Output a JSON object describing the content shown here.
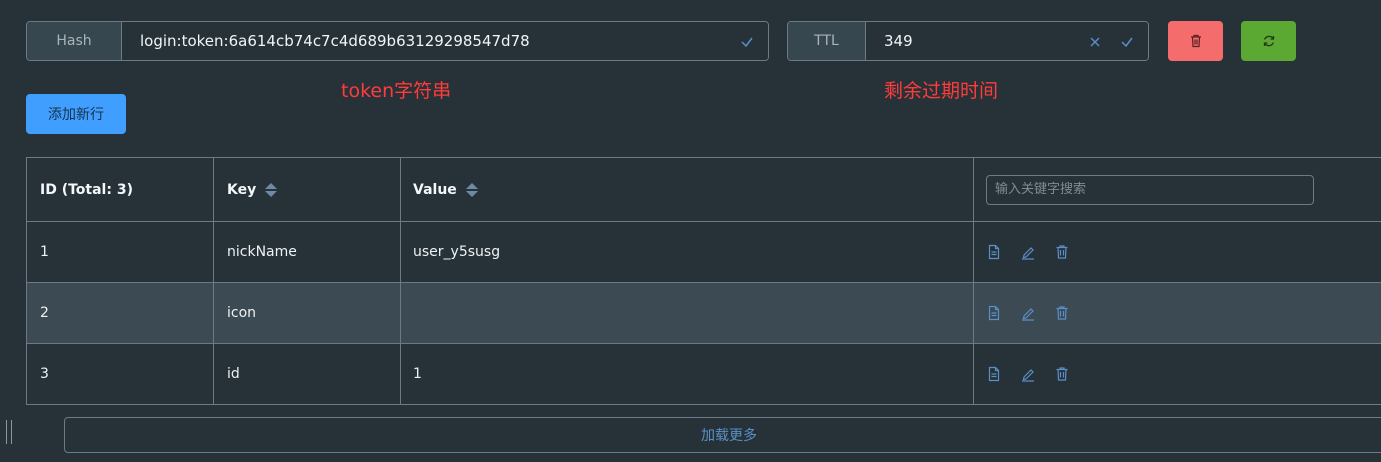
{
  "key_bar": {
    "type_label": "Hash",
    "key_value": "login:token:6a614cb74c7c4d689b63129298547d78",
    "ttl_label": "TTL",
    "ttl_value": "349"
  },
  "annotations": {
    "token_note": "token字符串",
    "ttl_note": "剩余过期时间"
  },
  "toolbar": {
    "add_row_label": "添加新行"
  },
  "table": {
    "headers": {
      "id": "ID (Total: 3)",
      "key": "Key",
      "value": "Value"
    },
    "search_placeholder": "输入关键字搜索",
    "rows": [
      {
        "id": "1",
        "key": "nickName",
        "value": "user_y5susg"
      },
      {
        "id": "2",
        "key": "icon",
        "value": ""
      },
      {
        "id": "3",
        "key": "id",
        "value": "1"
      }
    ]
  },
  "load_more_label": "加载更多",
  "colors": {
    "accent": "#409eff",
    "danger": "#f56c6c",
    "success": "#67c23a",
    "annotation": "#ff3b3b"
  }
}
